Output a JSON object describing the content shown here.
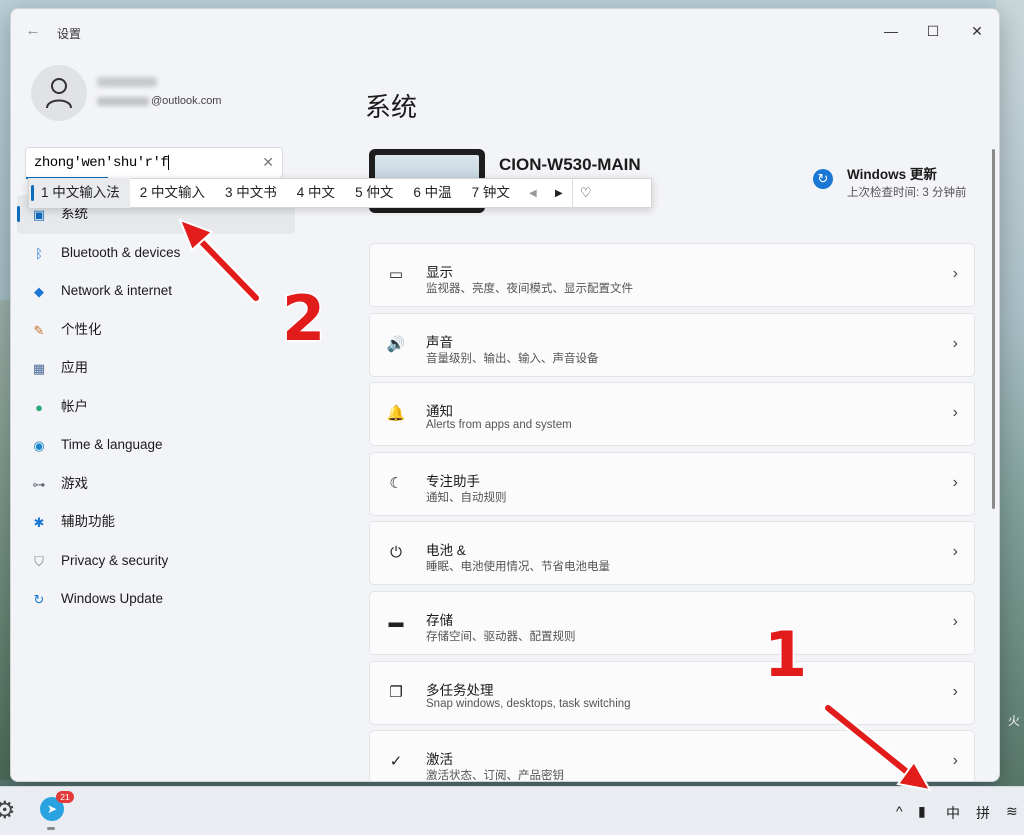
{
  "window": {
    "title": "设置",
    "back_glyph": "←",
    "minimize_glyph": "—",
    "maximize_glyph": "☐",
    "close_glyph": "✕"
  },
  "profile": {
    "email_suffix": "@outlook.com"
  },
  "search": {
    "value": "zhong'wen'shu'r'f",
    "clear_glyph": "✕"
  },
  "ime": {
    "candidates": [
      "1 中文输入法",
      "2 中文输入",
      "3 中文书",
      "4 中文",
      "5 仲文",
      "6 中温",
      "7 钟文"
    ],
    "prev_glyph": "◀",
    "next_glyph": "▶",
    "extra_glyph": "♡"
  },
  "nav": {
    "active_index": 0,
    "items": [
      {
        "label": "系统",
        "icon": "system-icon"
      },
      {
        "label": "Bluetooth & devices",
        "icon": "bluetooth-icon"
      },
      {
        "label": "Network & internet",
        "icon": "wifi-icon"
      },
      {
        "label": "个性化",
        "icon": "brush-icon"
      },
      {
        "label": "应用",
        "icon": "apps-icon"
      },
      {
        "label": "帐户",
        "icon": "account-icon"
      },
      {
        "label": "Time & language",
        "icon": "globe-icon"
      },
      {
        "label": "游戏",
        "icon": "gamepad-icon"
      },
      {
        "label": "辅助功能",
        "icon": "accessibility-icon"
      },
      {
        "label": "Privacy & security",
        "icon": "shield-icon"
      },
      {
        "label": "Windows Update",
        "icon": "update-icon"
      }
    ]
  },
  "main": {
    "title": "系统",
    "device_name": "CION-W530-MAIN",
    "update_title": "Windows 更新",
    "update_sub": "上次检查时间: 3 分钟前",
    "cards": [
      {
        "title": "显示",
        "sub": "监视器、亮度、夜间模式、显示配置文件",
        "icon": "monitor-icon",
        "glyph": "▭"
      },
      {
        "title": "声音",
        "sub": "音量级别、输出、输入、声音设备",
        "icon": "speaker-icon",
        "glyph": "🔊"
      },
      {
        "title": "通知",
        "sub": "Alerts from apps and system",
        "icon": "bell-icon",
        "glyph": "🔔"
      },
      {
        "title": "专注助手",
        "sub": "通知、自动规则",
        "icon": "moon-icon",
        "glyph": "☾"
      },
      {
        "title": "电池 &",
        "sub": "睡眠、电池使用情况、节省电池电量",
        "icon": "power-icon",
        "glyph": "⏻"
      },
      {
        "title": "存储",
        "sub": "存储空间、驱动器、配置规则",
        "icon": "storage-icon",
        "glyph": "▬"
      },
      {
        "title": "多任务处理",
        "sub": "Snap windows, desktops, task switching",
        "icon": "multitask-icon",
        "glyph": "❐"
      },
      {
        "title": "激活",
        "sub": "激活状态、订阅、产品密钥",
        "icon": "check-circle-icon",
        "glyph": "✓"
      }
    ],
    "chevron": "›"
  },
  "taskbar": {
    "badge": "21",
    "tray_chevron": "^",
    "ime_mode": "中",
    "ime_name": "拼",
    "wifi_glyph": "≋"
  },
  "annotations": {
    "num1": "1",
    "num2": "2"
  },
  "desktop": {
    "edge_text": "火"
  },
  "colors": {
    "accent": "#0f6cbd",
    "annotation": "#e21b1b"
  }
}
